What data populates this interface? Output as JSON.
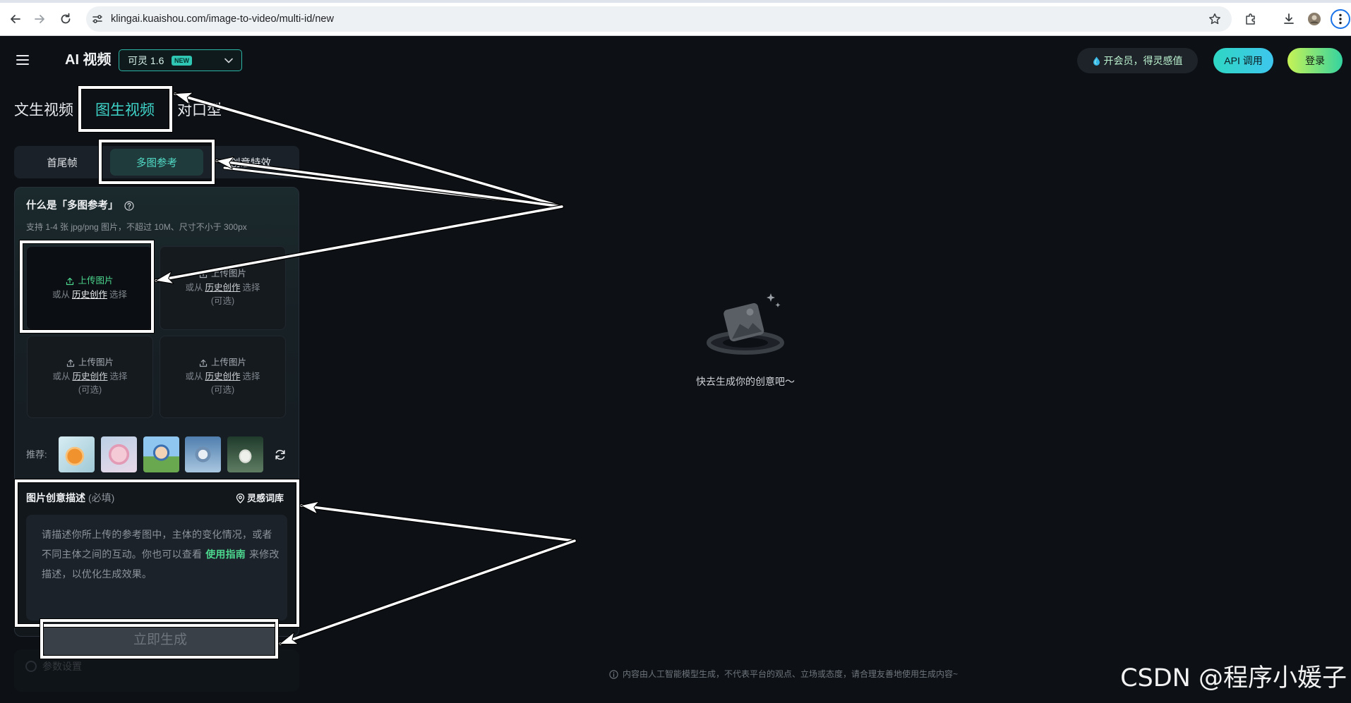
{
  "browser": {
    "url": "klingai.kuaishou.com/image-to-video/multi-id/new",
    "icons": [
      "back-icon",
      "forward-icon",
      "reload-icon",
      "site-info-icon",
      "bookmark-star-icon",
      "extensions-icon",
      "download-icon",
      "profile-avatar",
      "more-menu-icon"
    ]
  },
  "header": {
    "title": "AI 视频",
    "model": "可灵 1.6",
    "model_badge": "NEW",
    "vip_promo": "开会员，得灵感值",
    "api_button": "API 调用",
    "login_button": "登录"
  },
  "mode_tabs": [
    {
      "label": "文生视频",
      "active": false
    },
    {
      "label": "图生视频",
      "active": true
    },
    {
      "label": "对口型",
      "active": false
    }
  ],
  "sub_tabs": [
    {
      "label": "首尾帧",
      "active": false
    },
    {
      "label": "多图参考",
      "active": true
    },
    {
      "label": "创意特效",
      "active": false
    }
  ],
  "multi_reference": {
    "title": "什么是「多图参考」",
    "hint": "支持 1-4 张 jpg/png 图片，不超过 10M、尺寸不小于 300px"
  },
  "upload_tiles": [
    {
      "label": "上传图片",
      "or_from": "或从",
      "history": "历史创作",
      "select": "选择"
    },
    {
      "label": "上传图片",
      "or_from": "或从",
      "history": "历史创作",
      "select": "选择",
      "optional": "(可选)"
    },
    {
      "label": "上传图片",
      "or_from": "或从",
      "history": "历史创作",
      "select": "选择",
      "optional": "(可选)"
    },
    {
      "label": "上传图片",
      "or_from": "或从",
      "history": "历史创作",
      "select": "选择",
      "optional": "(可选)"
    }
  ],
  "recommend": {
    "label": "推荐:"
  },
  "description": {
    "title": "图片创意描述",
    "required": "(必填)",
    "inspiration": "灵感词库",
    "placeholder_line1": "请描述你所上传的参考图中，主体的变化情况，或者",
    "placeholder_line2_a": "不同主体之间的互动。你也可以查看",
    "guide_link": "使用指南",
    "placeholder_line2_b": "来修改",
    "placeholder_line3": "描述，以优化生成效果。"
  },
  "generate_button": "立即生成",
  "params_section": "参数设置",
  "empty_state": "快去生成你的创意吧～",
  "footer_notice": "内容由人工智能模型生成，不代表平台的观点、立场或态度，请合理友善地使用生成内容~",
  "watermark": "CSDN @程序小媛子",
  "colors": {
    "background": "#0d1116",
    "accent_teal": "#3fd3c8",
    "upload_green": "#4cd68e",
    "annotation": "#ffffff"
  }
}
